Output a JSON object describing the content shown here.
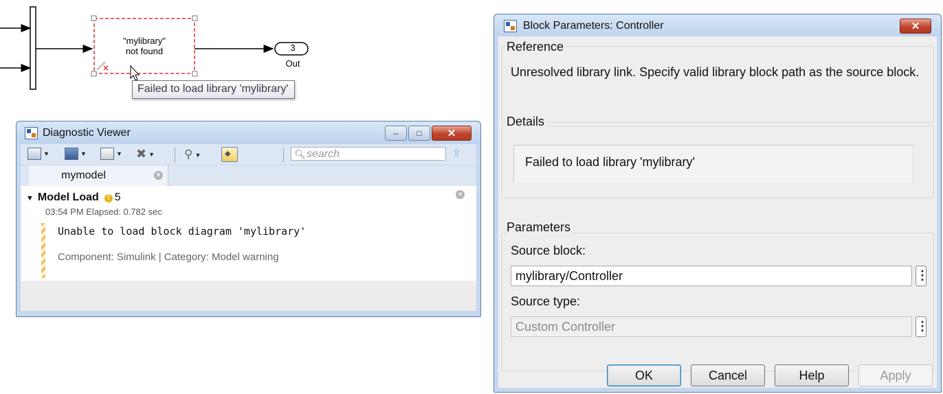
{
  "diagram": {
    "block_label_line1": "\"mylibrary\"",
    "block_label_line2": "not found",
    "outport_number": "3",
    "outport_label": "Out",
    "tooltip": "Failed to load library 'mylibrary'"
  },
  "diagnostic_viewer": {
    "title": "Diagnostic Viewer",
    "window_buttons": {
      "minimize": "–",
      "maximize": "□",
      "close": "✕"
    },
    "search_placeholder": "search",
    "tab_label": "mymodel",
    "section_title": "Model Load",
    "warning_count": "5",
    "timestamp": "03:54 PM   Elapsed: 0.782 sec",
    "message": "Unable to load block diagram 'mylibrary'",
    "meta": "Component:  Simulink | Category:  Model warning",
    "icons": [
      "layout-icon",
      "save-icon",
      "copy-icon",
      "clear-icon",
      "filter-icon",
      "highlight-icon",
      "search-icon",
      "up-arrow-icon"
    ]
  },
  "block_parameters": {
    "title": "Block Parameters: Controller",
    "close_glyph": "✕",
    "reference_label": "Reference",
    "reference_text": "Unresolved library link. Specify valid library block path as the source block.",
    "details_label": "Details",
    "details_text": "Failed to load library 'mylibrary'",
    "parameters_label": "Parameters",
    "source_block_label": "Source block:",
    "source_block_value": "mylibrary/Controller",
    "source_type_label": "Source type:",
    "source_type_value": "Custom Controller",
    "buttons": {
      "ok": "OK",
      "cancel": "Cancel",
      "help": "Help",
      "apply": "Apply"
    }
  },
  "colors": {
    "window_frame": "#c5d8ef",
    "close_button": "#c0452c",
    "missing_block_border": "#e03030",
    "warning_badge": "#e7b417"
  }
}
